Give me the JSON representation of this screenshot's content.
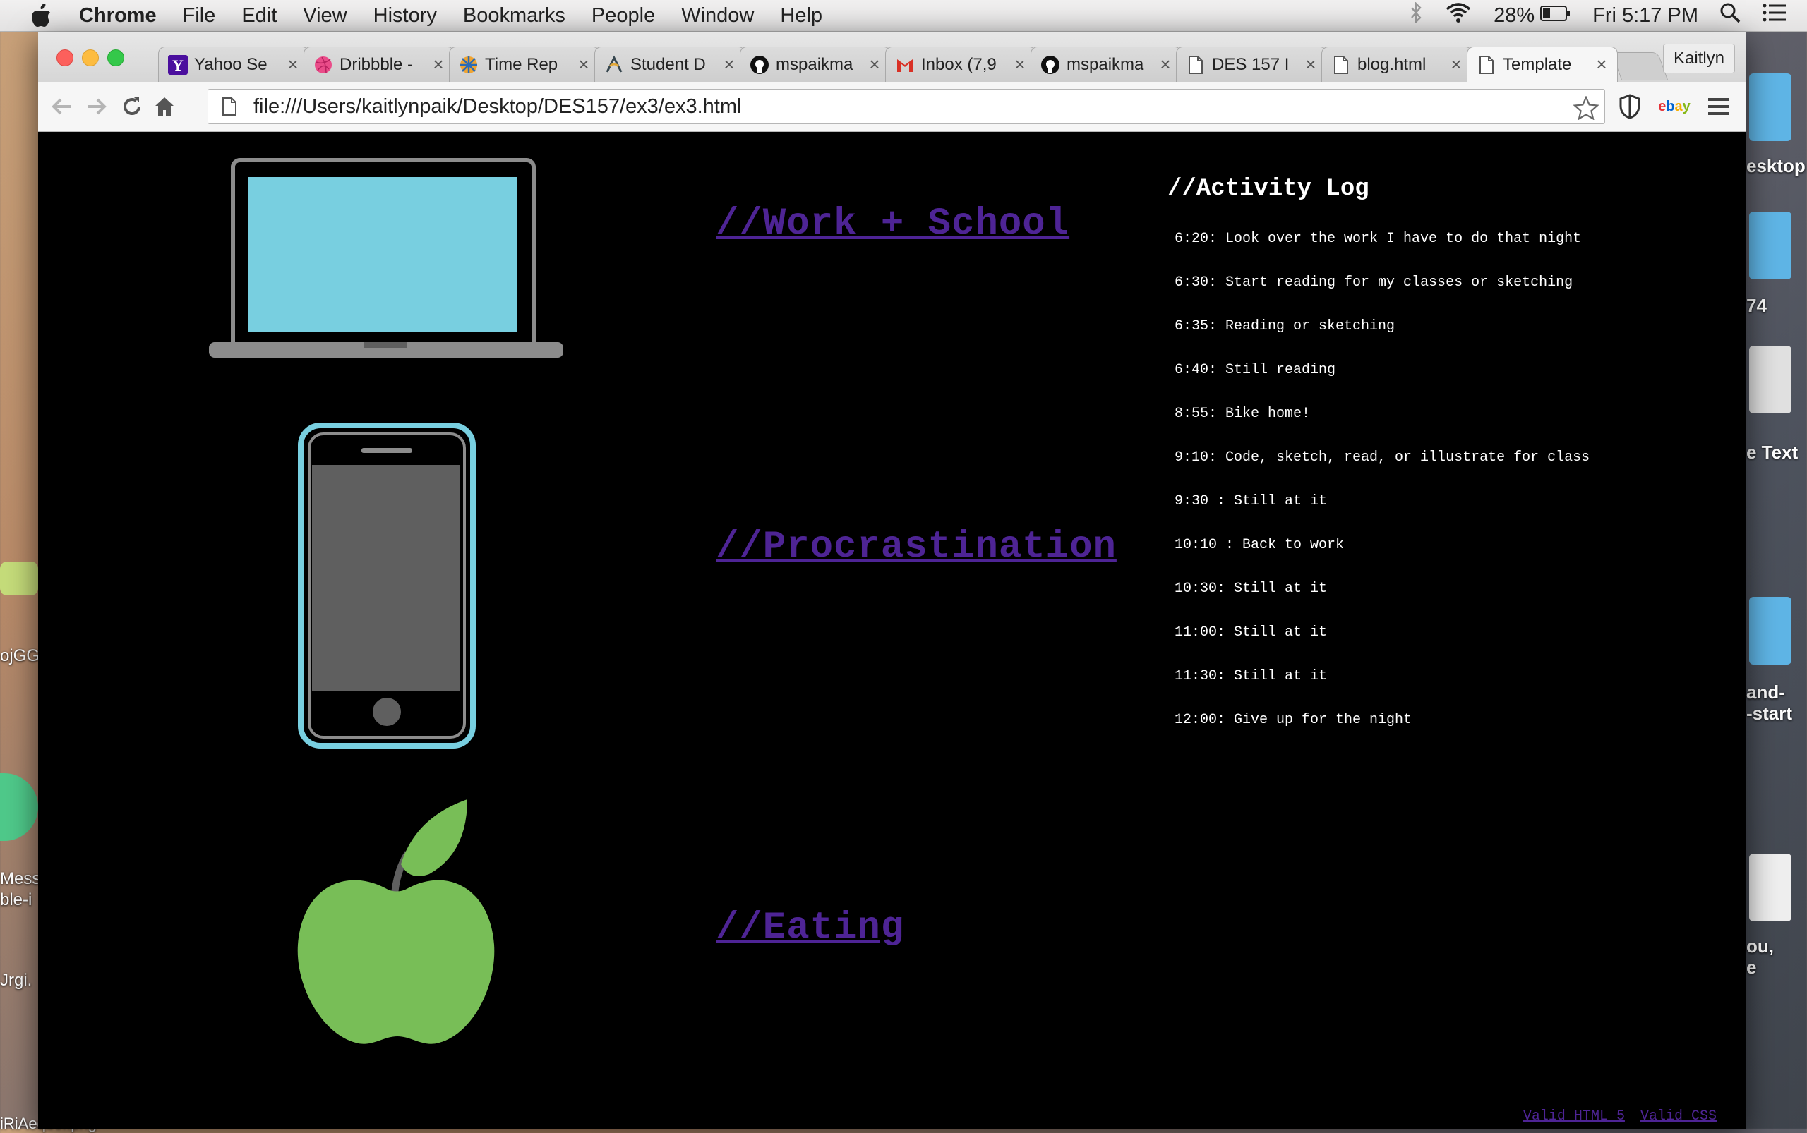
{
  "menubar": {
    "app": "Chrome",
    "items": [
      "File",
      "Edit",
      "View",
      "History",
      "Bookmarks",
      "People",
      "Window",
      "Help"
    ],
    "battery": "28%",
    "clock": "Fri 5:17 PM"
  },
  "desktop": {
    "right_labels": [
      "esktop",
      "74",
      "e Text",
      "and-",
      "-start",
      "ou,",
      "e"
    ],
    "left_labels": [
      "ojGG",
      "Mess",
      "ble-i",
      "Jrgi.",
      "iRiAeqbcI.png"
    ]
  },
  "tabs": [
    {
      "label": "Yahoo Se",
      "icon": "yahoo-icon"
    },
    {
      "label": "Dribbble -",
      "icon": "dribbble-icon"
    },
    {
      "label": "Time Rep",
      "icon": "time-report-icon"
    },
    {
      "label": "Student D",
      "icon": "student-icon"
    },
    {
      "label": "mspaikma",
      "icon": "github-icon"
    },
    {
      "label": "Inbox (7,9",
      "icon": "gmail-icon"
    },
    {
      "label": "mspaikma",
      "icon": "github-icon"
    },
    {
      "label": "DES 157 I",
      "icon": "page-icon"
    },
    {
      "label": "blog.html",
      "icon": "page-icon"
    },
    {
      "label": "Template",
      "icon": "page-icon"
    }
  ],
  "profile": "Kaitlyn",
  "address": "file:///Users/kaitlynpaik/Desktop/DES157/ex3/ex3.html",
  "ext_ebay": "ebay",
  "page": {
    "links": [
      "//Work + School",
      "//Procrastination",
      "//Eating"
    ],
    "log_title": "//Activity Log",
    "log": [
      "6:20: Look over the work I have to do that night",
      "6:30: Start reading for my classes or sketching",
      "6:35: Reading or sketching",
      "6:40: Still reading",
      "8:55: Bike home!",
      "9:10: Code, sketch, read, or illustrate for class",
      "9:30 : Still at it",
      "10:10 : Back to work",
      "10:30: Still at it",
      "11:00: Still at it",
      "11:30: Still at it",
      "12:00: Give up for the night"
    ],
    "footer": [
      "Valid HTML 5",
      "Valid CSS"
    ]
  },
  "colors": {
    "link": "#4e2495",
    "laptop_screen": "#78cfe0",
    "phone_border": "#78cfe0",
    "apple": "#78be57"
  }
}
